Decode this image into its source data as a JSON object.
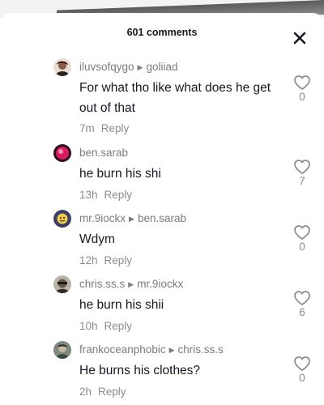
{
  "header": {
    "title": "601 comments",
    "close_icon": "close-icon"
  },
  "comments": [
    {
      "username": "iluvsofqygo",
      "reply_to": "goliiad",
      "text": "For what tho like what does he get out of that",
      "time": "7m",
      "reply_label": "Reply",
      "likes": "0",
      "avatar_color": "#6b4a3a"
    },
    {
      "username": "ben.sarab",
      "reply_to": "",
      "text": "he burn his shi",
      "time": "13h",
      "reply_label": "Reply",
      "likes": "7",
      "avatar_color": "#c2185b"
    },
    {
      "username": "mr.9iockx",
      "reply_to": "ben.sarab",
      "text": "Wdym",
      "time": "12h",
      "reply_label": "Reply",
      "likes": "0",
      "avatar_color": "#4a4f7a"
    },
    {
      "username": "chris.ss.s",
      "reply_to": "mr.9iockx",
      "text": "he burn his shii",
      "time": "10h",
      "reply_label": "Reply",
      "likes": "6",
      "avatar_color": "#3f3a34"
    },
    {
      "username": "frankoceanphobic",
      "reply_to": "chris.ss.s",
      "text": "He burns his clothes?",
      "time": "2h",
      "reply_label": "Reply",
      "likes": "0",
      "avatar_color": "#5a6b5e"
    }
  ]
}
